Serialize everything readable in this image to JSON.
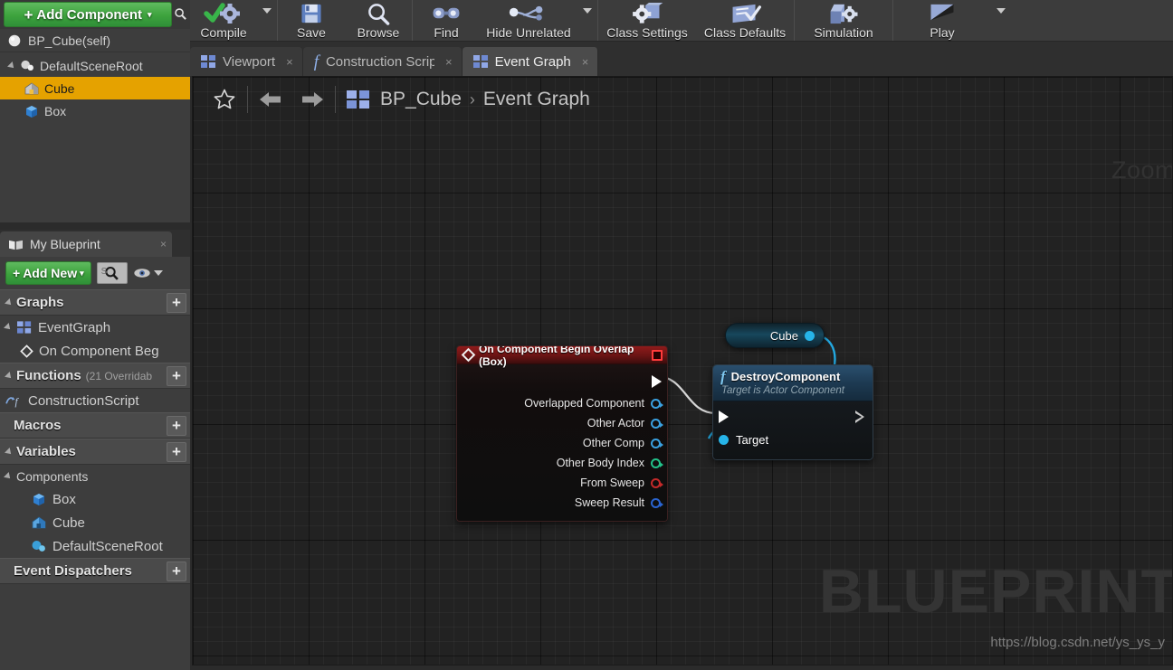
{
  "components_panel": {
    "add_component_label": "Add Component",
    "add_component_caret": "▾",
    "plus": "+",
    "search_icon": "search-icon",
    "self_row": "BP_Cube(self)",
    "tree": [
      {
        "label": "DefaultSceneRoot",
        "icon": "scene-root-icon",
        "depth": 0,
        "selected": false
      },
      {
        "label": "Cube",
        "icon": "static-mesh-icon",
        "depth": 1,
        "selected": true
      },
      {
        "label": "Box",
        "icon": "box-collision-icon",
        "depth": 1,
        "selected": false
      }
    ]
  },
  "toolbar": {
    "groups": [
      {
        "buttons": [
          {
            "label": "Compile",
            "icon": "compile-icon",
            "caret": true,
            "wide": false
          }
        ]
      },
      {
        "buttons": [
          {
            "label": "Save",
            "icon": "save-icon",
            "caret": false,
            "wide": false
          },
          {
            "label": "Browse",
            "icon": "browse-icon",
            "caret": false,
            "wide": false
          }
        ]
      },
      {
        "buttons": [
          {
            "label": "Find",
            "icon": "find-icon",
            "caret": false,
            "wide": false
          },
          {
            "label": "Hide Unrelated",
            "icon": "hide-unrelated-icon",
            "caret": true,
            "wide": true
          }
        ]
      },
      {
        "buttons": [
          {
            "label": "Class Settings",
            "icon": "class-settings-icon",
            "caret": false,
            "wide": true
          },
          {
            "label": "Class Defaults",
            "icon": "class-defaults-icon",
            "caret": false,
            "wide": true
          }
        ]
      },
      {
        "buttons": [
          {
            "label": "Simulation",
            "icon": "simulation-icon",
            "caret": false,
            "wide": true
          }
        ]
      },
      {
        "buttons": [
          {
            "label": "Play",
            "icon": "play-icon",
            "caret": true,
            "wide": true
          }
        ]
      }
    ]
  },
  "graph_tabs": [
    {
      "label": "Viewport",
      "icon": "viewport-icon",
      "active": false,
      "close": "×"
    },
    {
      "label": "Construction Scrip",
      "icon": "function-icon",
      "active": false,
      "close": "×"
    },
    {
      "label": "Event Graph",
      "icon": "event-graph-icon",
      "active": true,
      "close": "×"
    }
  ],
  "graph_bar": {
    "star_icon": "favorite-star-icon",
    "back_icon": "back-arrow-icon",
    "forward_icon": "forward-arrow-icon",
    "graph_icon": "event-graph-icon",
    "breadcrumb_root": "BP_Cube",
    "breadcrumb_sep": "›",
    "breadcrumb_current": "Event Graph",
    "zoom_label": "Zoom"
  },
  "watermark": {
    "text": "BLUEPRINT",
    "url": "https://blog.csdn.net/ys_ys_y"
  },
  "my_blueprint": {
    "tab_label": "My Blueprint",
    "tab_icon": "blueprint-book-icon",
    "tab_close": "×",
    "add_new_label": "Add New",
    "add_new_caret": "▾",
    "add_new_plus": "+",
    "search_placeholder": "S",
    "search_icon": "search-icon",
    "eye_icon": "eye-icon",
    "sections": [
      {
        "title": "Graphs",
        "sub": "",
        "plus": "+",
        "collapsible": true
      },
      {
        "title": "Functions",
        "sub": "(21 Overridab",
        "plus": "+",
        "collapsible": true
      },
      {
        "title": "Macros",
        "sub": "",
        "plus": "+",
        "collapsible": false
      },
      {
        "title": "Variables",
        "sub": "",
        "plus": "+",
        "collapsible": true
      },
      {
        "title": "Event Dispatchers",
        "sub": "",
        "plus": "+",
        "collapsible": false
      }
    ],
    "graphs_items": [
      {
        "label": "EventGraph",
        "icon": "event-graph-icon"
      },
      {
        "label": "On Component Beg",
        "icon": "event-node-icon"
      }
    ],
    "functions_items": [
      {
        "label": "ConstructionScript",
        "icon": "construction-script-icon"
      }
    ],
    "variables_group": "Components",
    "variables_items": [
      {
        "label": "Box",
        "icon": "box-collision-icon"
      },
      {
        "label": "Cube",
        "icon": "static-mesh-icon"
      },
      {
        "label": "DefaultSceneRoot",
        "icon": "scene-root-icon"
      }
    ]
  },
  "nodes": {
    "event_node": {
      "title": "On Component Begin Overlap (Box)",
      "title_icon": "event-diamond-icon",
      "close_icon": "node-close-icon",
      "header_color": "#7a1818",
      "exec_out": "exec-out-pin",
      "pins": [
        {
          "label": "Overlapped Component",
          "color": "blue"
        },
        {
          "label": "Other Actor",
          "color": "blue"
        },
        {
          "label": "Other Comp",
          "color": "blue"
        },
        {
          "label": "Other Body Index",
          "color": "green"
        },
        {
          "label": "From Sweep",
          "color": "red"
        },
        {
          "label": "Sweep Result",
          "color": "blue2"
        }
      ]
    },
    "function_node": {
      "title": "DestroyComponent",
      "subtitle": "Target is Actor Component",
      "fn_glyph": "f",
      "header_color": "#224866",
      "exec_in": "exec-in-pin",
      "exec_out": "exec-out-pin",
      "target_pin": "Target"
    },
    "variable_node": {
      "label": "Cube",
      "pin_color": "#26b4e8"
    }
  },
  "colors": {
    "panel_bg": "#3d3d3d",
    "graph_bg": "#222222",
    "accent_green": "#3da33d",
    "selection_orange": "#e5a200",
    "exec_wire": "#d8d8d8",
    "data_wire": "#23a8e0"
  }
}
